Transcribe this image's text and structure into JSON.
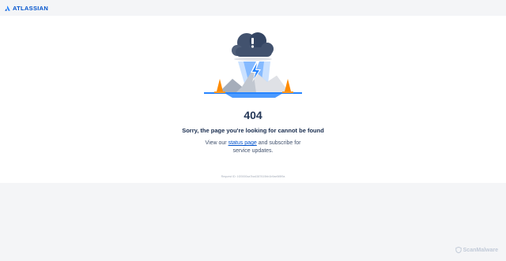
{
  "header": {
    "brand": "ATLASSIAN"
  },
  "error": {
    "code": "404",
    "headline": "Sorry, the page you're looking for cannot be found",
    "desc_prefix": "View our ",
    "status_link": "status page",
    "desc_suffix_1": " and subscribe for",
    "desc_line2": "service updates.",
    "request_id": "Request ID: 1f20000ca7ba4387619bb1b9ae5f8f9a"
  },
  "watermark": {
    "label": "ScanMalware"
  },
  "colors": {
    "brand": "#0052cc",
    "cloud": "#42526e",
    "bolt": "#2684ff",
    "cone": "#ff8b00",
    "water": "#4c9aff"
  }
}
